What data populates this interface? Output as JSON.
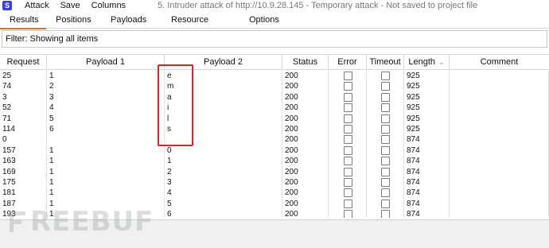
{
  "menu": {
    "app_icon": "burp-s-icon",
    "app_icon_glyph": "S",
    "items": [
      "Attack",
      "Save",
      "Columns"
    ],
    "window_title": "5. Intruder attack of http://10.9.28.145 - Temporary attack - Not saved to project file"
  },
  "tabs": [
    {
      "label": "Results",
      "active": true
    },
    {
      "label": "Positions",
      "active": false
    },
    {
      "label": "Payloads",
      "active": false
    },
    {
      "label": "Resource Pool",
      "active": false
    },
    {
      "label": "Options",
      "active": false
    }
  ],
  "filter": {
    "text": "Filter: Showing all items"
  },
  "table": {
    "columns": [
      "Request",
      "Payload 1",
      "Payload 2",
      "Status",
      "Error",
      "Timeout",
      "Length",
      "Comment"
    ],
    "sorted_column": "Length",
    "sort_icon": "chevron-down-icon",
    "rows": [
      {
        "request": "25",
        "payload1": "1",
        "payload2": "e",
        "status": "200",
        "error": false,
        "timeout": false,
        "length": "925",
        "comment": ""
      },
      {
        "request": "74",
        "payload1": "2",
        "payload2": "m",
        "status": "200",
        "error": false,
        "timeout": false,
        "length": "925",
        "comment": ""
      },
      {
        "request": "3",
        "payload1": "3",
        "payload2": "a",
        "status": "200",
        "error": false,
        "timeout": false,
        "length": "925",
        "comment": ""
      },
      {
        "request": "52",
        "payload1": "4",
        "payload2": "i",
        "status": "200",
        "error": false,
        "timeout": false,
        "length": "925",
        "comment": ""
      },
      {
        "request": "71",
        "payload1": "5",
        "payload2": "l",
        "status": "200",
        "error": false,
        "timeout": false,
        "length": "925",
        "comment": ""
      },
      {
        "request": "114",
        "payload1": "6",
        "payload2": "s",
        "status": "200",
        "error": false,
        "timeout": false,
        "length": "925",
        "comment": ""
      },
      {
        "request": "0",
        "payload1": "",
        "payload2": "",
        "status": "200",
        "error": false,
        "timeout": false,
        "length": "874",
        "comment": ""
      },
      {
        "request": "157",
        "payload1": "1",
        "payload2": "0",
        "status": "200",
        "error": false,
        "timeout": false,
        "length": "874",
        "comment": ""
      },
      {
        "request": "163",
        "payload1": "1",
        "payload2": "1",
        "status": "200",
        "error": false,
        "timeout": false,
        "length": "874",
        "comment": ""
      },
      {
        "request": "169",
        "payload1": "1",
        "payload2": "2",
        "status": "200",
        "error": false,
        "timeout": false,
        "length": "874",
        "comment": ""
      },
      {
        "request": "175",
        "payload1": "1",
        "payload2": "3",
        "status": "200",
        "error": false,
        "timeout": false,
        "length": "874",
        "comment": ""
      },
      {
        "request": "181",
        "payload1": "1",
        "payload2": "4",
        "status": "200",
        "error": false,
        "timeout": false,
        "length": "874",
        "comment": ""
      },
      {
        "request": "187",
        "payload1": "1",
        "payload2": "5",
        "status": "200",
        "error": false,
        "timeout": false,
        "length": "874",
        "comment": ""
      },
      {
        "request": "193",
        "payload1": "1",
        "payload2": "6",
        "status": "200",
        "error": false,
        "timeout": false,
        "length": "874",
        "comment": ""
      }
    ]
  },
  "annotation": {
    "color": "#e2211c"
  },
  "watermark": {
    "text": "REEBUF"
  },
  "colors": {
    "accent": "#e0702a",
    "app_icon": "#3b3fe0"
  }
}
